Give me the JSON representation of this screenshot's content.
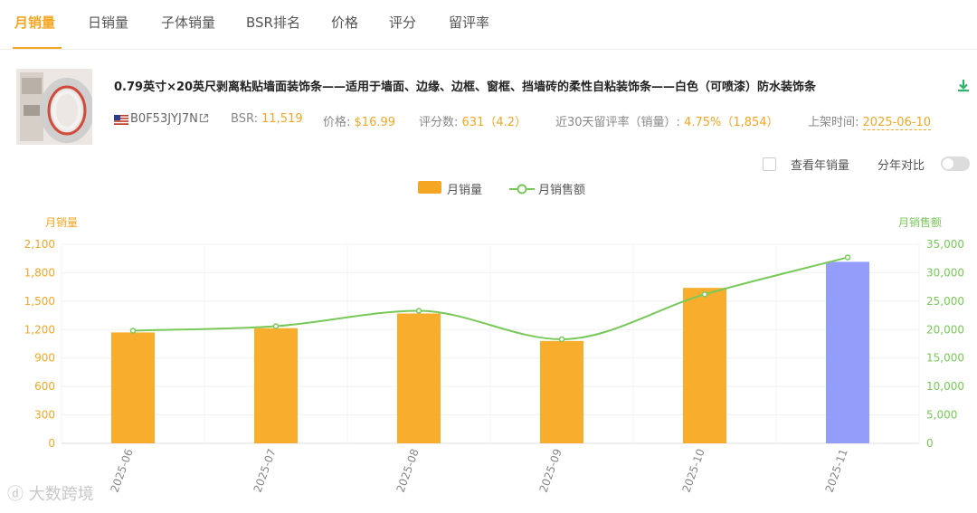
{
  "tabs": [
    {
      "label": "月销量",
      "active": true
    },
    {
      "label": "日销量",
      "active": false
    },
    {
      "label": "子体销量",
      "active": false
    },
    {
      "label": "BSR排名",
      "active": false
    },
    {
      "label": "价格",
      "active": false
    },
    {
      "label": "评分",
      "active": false
    },
    {
      "label": "留评率",
      "active": false
    }
  ],
  "product": {
    "title": "0.79英寸×20英尺剥离粘贴墙面装饰条——适用于墙面、边缘、边框、窗框、挡墙砖的柔性自粘装饰条——白色（可喷漆）防水装饰条",
    "asin": "B0F53JYJ7N",
    "bsr_label": "BSR:",
    "bsr_value": "11,519",
    "price_label": "价格:",
    "price_value": "$16.99",
    "rating_label": "评分数:",
    "rating_value": "631（4.2）",
    "review_rate_label": "近30天留评率（销量）:",
    "review_rate_value": "4.75%（1,854）",
    "launch_label": "上架时间:",
    "launch_value": "2025-06-10"
  },
  "controls": {
    "year_sales_label": "查看年销量",
    "year_compare_label": "分年对比"
  },
  "watermark": "大数跨境",
  "colors": {
    "accent": "#f5a623",
    "bar": "#f8ad2c",
    "bar_highlight": "#939efa",
    "line": "#78c95a"
  },
  "chart_data": {
    "type": "bar",
    "categories": [
      "2025-06",
      "2025-07",
      "2025-08",
      "2025-09",
      "2025-10",
      "2025-11"
    ],
    "series": [
      {
        "name": "月销量",
        "type": "bar",
        "axis": "left",
        "values": [
          1170,
          1215,
          1370,
          1080,
          1640,
          1915
        ]
      },
      {
        "name": "月销售额",
        "type": "line",
        "axis": "right",
        "values": [
          19800,
          20600,
          23300,
          18300,
          26200,
          32700
        ]
      }
    ],
    "highlight_index": 5,
    "ylabel": "月销量",
    "ylabel_right": "月销售额",
    "ylim": [
      0,
      2100
    ],
    "ylim_right": [
      0,
      35000
    ],
    "yticks": [
      "0",
      "300",
      "600",
      "900",
      "1,200",
      "1,500",
      "1,800",
      "2,100"
    ],
    "yticks_right": [
      "0",
      "5,000",
      "10,000",
      "15,000",
      "20,000",
      "25,000",
      "30,000",
      "35,000"
    ],
    "grid": true,
    "legend": "top-center"
  }
}
